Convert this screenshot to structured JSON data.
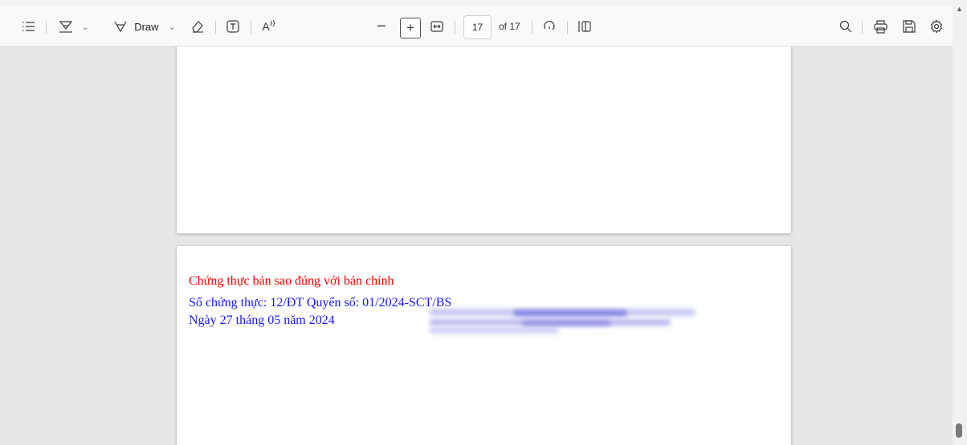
{
  "toolbar": {
    "draw_label": "Draw",
    "highlight_caret": "⌄",
    "draw_caret": "⌄",
    "read_aloud_label": "A",
    "zoom_out": "−",
    "zoom_in": "+",
    "page_number": "17",
    "page_of": "of 17"
  },
  "document": {
    "cert_title": "Chứng thực bản sao đúng với bản chính",
    "cert_number": "Số chứng thực: 12/ĐT Quyển số: 01/2024-SCT/BS",
    "cert_date": "Ngày 27 tháng 05 năm 2024"
  },
  "scrollbar": {
    "up_arrow": "▲",
    "position": 0.97
  }
}
